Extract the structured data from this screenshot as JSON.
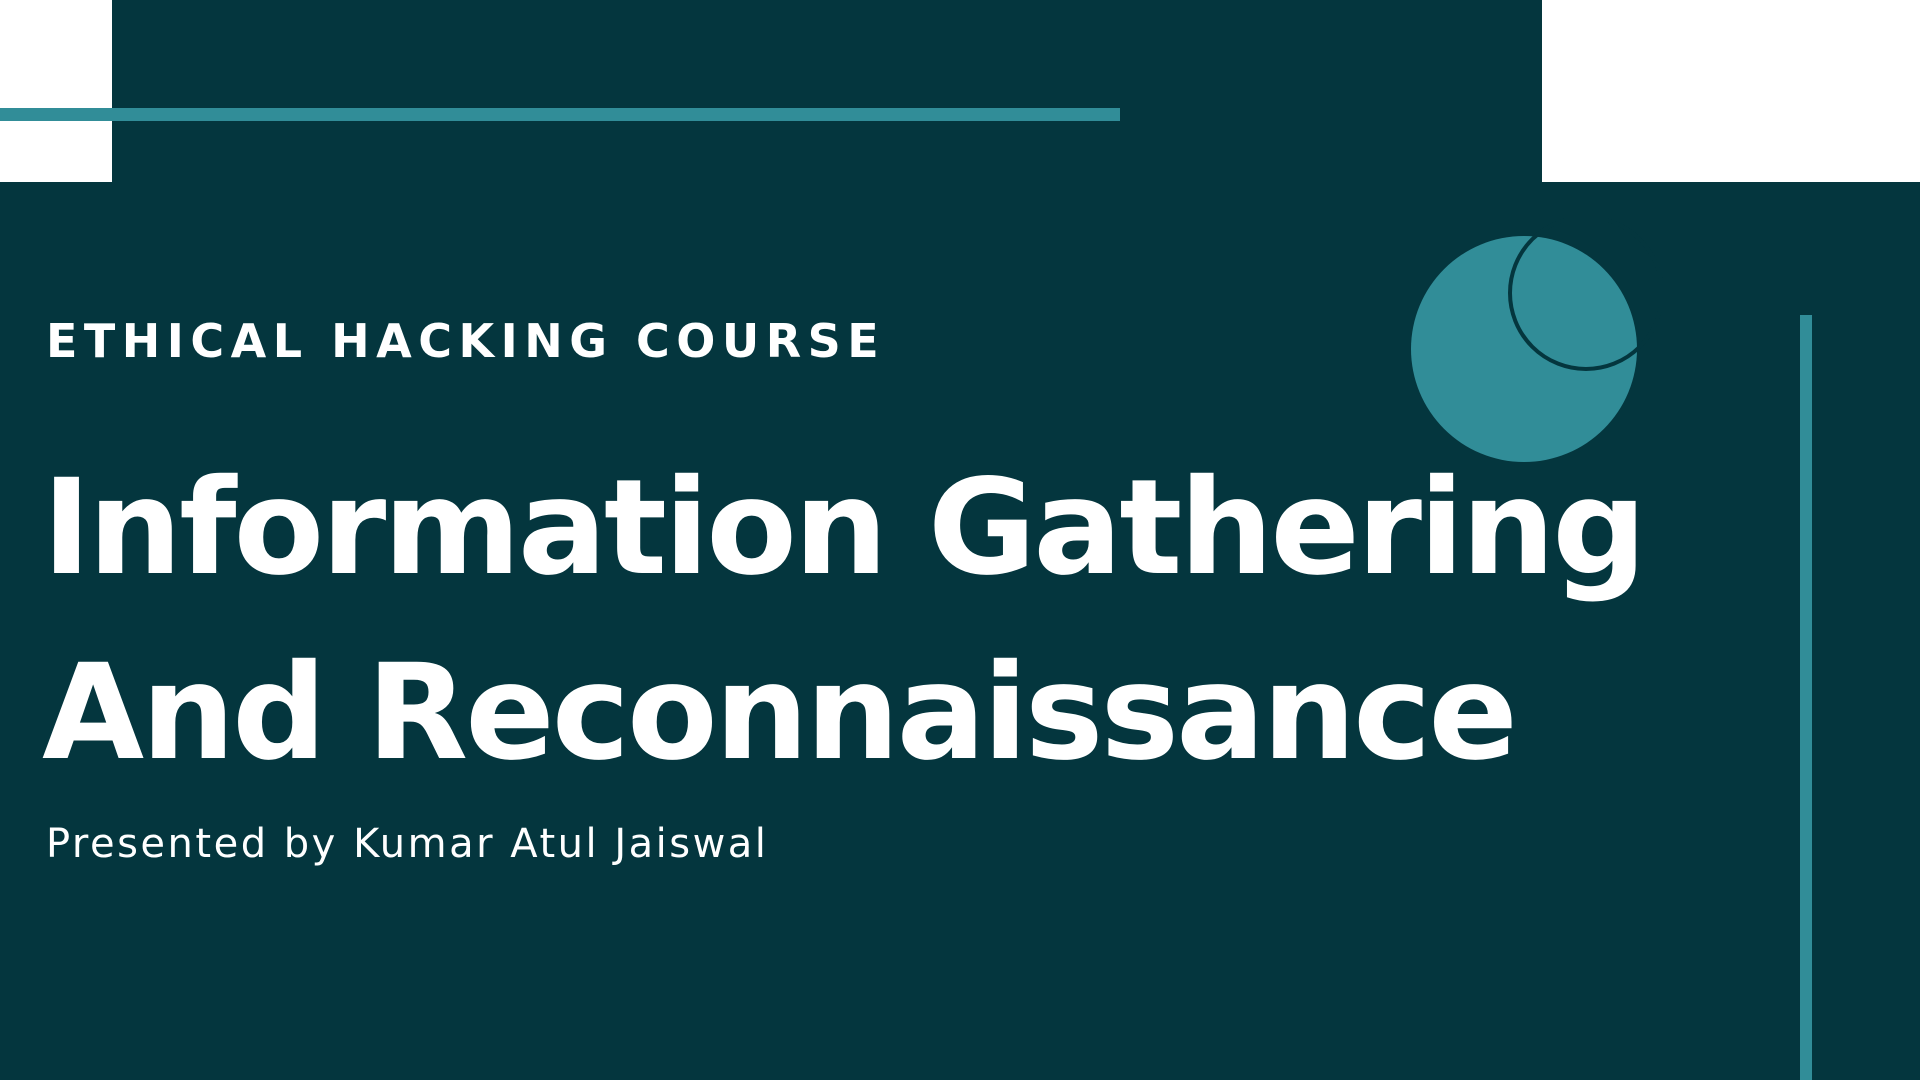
{
  "slide": {
    "eyebrow": "ETHICAL HACKING COURSE",
    "title_line_1": "Information Gathering",
    "title_line_2": "And Reconnaissance",
    "presenter": "Presented by Kumar Atul Jaiswal"
  },
  "colors": {
    "background": "#04363E",
    "accent": "#318D98",
    "white": "#FFFFFF",
    "text": "#FFFFFF"
  }
}
